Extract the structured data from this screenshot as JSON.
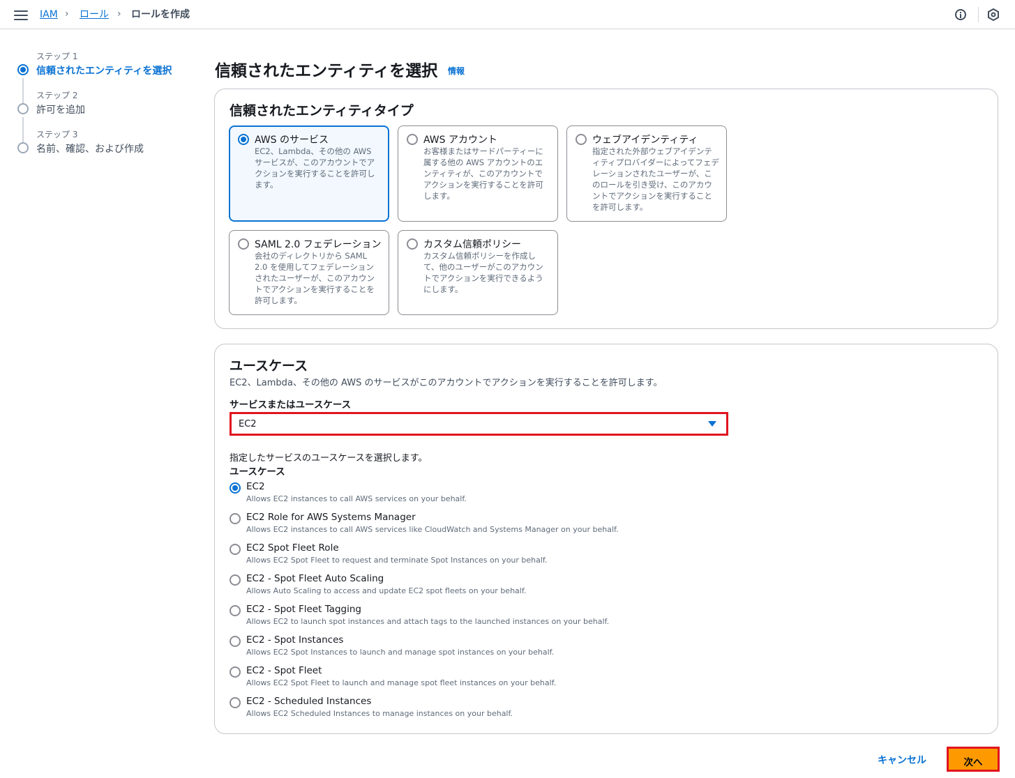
{
  "breadcrumb": {
    "items": [
      "IAM",
      "ロール",
      "ロールを作成"
    ]
  },
  "steps": [
    {
      "label": "ステップ 1",
      "title": "信頼されたエンティティを選択",
      "active": true
    },
    {
      "label": "ステップ 2",
      "title": "許可を追加",
      "active": false
    },
    {
      "label": "ステップ 3",
      "title": "名前、確認、および作成",
      "active": false
    }
  ],
  "page": {
    "title": "信頼されたエンティティを選択",
    "info_link": "情報"
  },
  "entity_type": {
    "heading": "信頼されたエンティティタイプ",
    "tiles": [
      {
        "title": "AWS のサービス",
        "desc": "EC2、Lambda、その他の AWS サービスが、このアカウントでアクションを実行することを許可します。",
        "selected": true
      },
      {
        "title": "AWS アカウント",
        "desc": "お客様またはサードパーティーに属する他の AWS アカウントのエンティティが、このアカウントでアクションを実行することを許可します。",
        "selected": false
      },
      {
        "title": "ウェブアイデンティティ",
        "desc": "指定された外部ウェブアイデンティティプロバイダーによってフェデレーションされたユーザーが、このロールを引き受け、このアカウントでアクションを実行することを許可します。",
        "selected": false
      },
      {
        "title": "SAML 2.0 フェデレーション",
        "desc": "会社のディレクトリから SAML 2.0 を使用してフェデレーションされたユーザーが、このアカウントでアクションを実行することを許可します。",
        "selected": false
      },
      {
        "title": "カスタム信頼ポリシー",
        "desc": "カスタム信頼ポリシーを作成して、他のユーザーがこのアカウントでアクションを実行できるようにします。",
        "selected": false
      }
    ]
  },
  "use_case": {
    "heading": "ユースケース",
    "description": "EC2、Lambda、その他の AWS のサービスがこのアカウントでアクションを実行することを許可します。",
    "service_label": "サービスまたはユースケース",
    "service_value": "EC2",
    "hint": "指定したサービスのユースケースを選択します。",
    "options_label": "ユースケース",
    "options": [
      {
        "name": "EC2",
        "desc": "Allows EC2 instances to call AWS services on your behalf.",
        "checked": true
      },
      {
        "name": "EC2 Role for AWS Systems Manager",
        "desc": "Allows EC2 instances to call AWS services like CloudWatch and Systems Manager on your behalf.",
        "checked": false
      },
      {
        "name": "EC2 Spot Fleet Role",
        "desc": "Allows EC2 Spot Fleet to request and terminate Spot Instances on your behalf.",
        "checked": false
      },
      {
        "name": "EC2 - Spot Fleet Auto Scaling",
        "desc": "Allows Auto Scaling to access and update EC2 spot fleets on your behalf.",
        "checked": false
      },
      {
        "name": "EC2 - Spot Fleet Tagging",
        "desc": "Allows EC2 to launch spot instances and attach tags to the launched instances on your behalf.",
        "checked": false
      },
      {
        "name": "EC2 - Spot Instances",
        "desc": "Allows EC2 Spot Instances to launch and manage spot instances on your behalf.",
        "checked": false
      },
      {
        "name": "EC2 - Spot Fleet",
        "desc": "Allows EC2 Spot Fleet to launch and manage spot fleet instances on your behalf.",
        "checked": false
      },
      {
        "name": "EC2 - Scheduled Instances",
        "desc": "Allows EC2 Scheduled Instances to manage instances on your behalf.",
        "checked": false
      }
    ]
  },
  "footer": {
    "cancel": "キャンセル",
    "next": "次へ"
  },
  "colors": {
    "accent": "#0972d3",
    "primary_button": "#ff9900",
    "highlight_border": "#e0141f"
  }
}
